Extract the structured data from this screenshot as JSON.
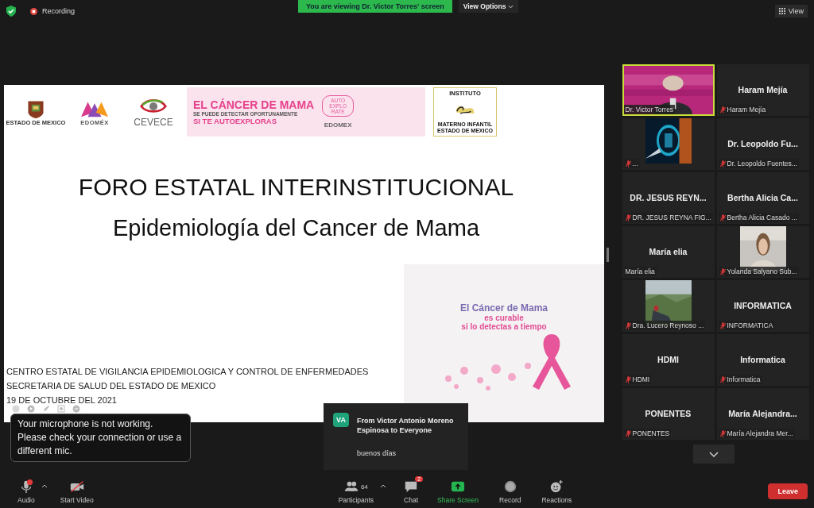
{
  "top_bar": {
    "recording_label": "Recording",
    "viewing_banner": "You are viewing Dr. Victor Torres' screen",
    "view_options": "View Options",
    "view_button": "View"
  },
  "slide": {
    "logos": [
      {
        "kind": "crest",
        "caption": "ESTADO DE MEXICO"
      },
      {
        "kind": "edomex",
        "caption": "EDOMÉX"
      },
      {
        "kind": "eye",
        "caption": "CEVECE"
      }
    ],
    "banner": {
      "headline": "EL CÁNCER DE MAMA",
      "line_2": "SE PUEDE DETECTAR OPORTUNAMENTE",
      "line_3": "SI TE AUTOEXPLORAS",
      "badge": "AUTO EXPLO RATE",
      "footer_logo": "EDOMEX"
    },
    "institute": {
      "top": "INSTITUTO",
      "bottom": "MATERNO INFANTIL ESTADO DE MEXICO"
    },
    "title": "FORO ESTATAL INTERINSTITUCIONAL",
    "subtitle": "Epidemiología del Cancer de Mama",
    "footer_lines": [
      "CENTRO ESTATAL DE VIGILANCIA EPIDEMIOLOGICA Y CONTROL DE ENFERMEDADES",
      "SECRETARIA DE SALUD DEL ESTADO DE MEXICO",
      "19 DE OCTUBRE DEL 2021"
    ],
    "poster": {
      "line_1": "El Cáncer de Mama",
      "line_2": "es curable",
      "line_3": "si lo detectas a tiempo"
    }
  },
  "participants": [
    {
      "kind": "video",
      "label": "Dr. Victor Torres",
      "muted": false,
      "speaking": true
    },
    {
      "kind": "name",
      "display": "Haram Mejía",
      "label": "Haram Mejía",
      "muted": true,
      "speaking": false
    },
    {
      "kind": "video",
      "label": "...",
      "muted": true,
      "speaking": false
    },
    {
      "kind": "name",
      "display": "Dr. Leopoldo Fu...",
      "label": "Dr. Leopoldo Fuentes...",
      "muted": true,
      "speaking": false
    },
    {
      "kind": "name",
      "display": "DR. JESUS REYN...",
      "label": "DR. JESUS REYNA FIG...",
      "muted": true,
      "speaking": false
    },
    {
      "kind": "name",
      "display": "Bertha Alicia Ca...",
      "label": "Bertha Alicia Casado ...",
      "muted": true,
      "speaking": false
    },
    {
      "kind": "name",
      "display": "María elia",
      "label": "María elia",
      "muted": false,
      "speaking": false
    },
    {
      "kind": "video",
      "label": "Yolanda Salyano Sub...",
      "muted": true,
      "speaking": false
    },
    {
      "kind": "video",
      "label": "Dra. Lucero Reynoso ...",
      "muted": true,
      "speaking": false
    },
    {
      "kind": "name",
      "display": "INFORMATICA",
      "label": "INFORMATICA",
      "muted": true,
      "speaking": false
    },
    {
      "kind": "name",
      "display": "HDMI",
      "label": "HDMI",
      "muted": true,
      "speaking": false
    },
    {
      "kind": "name",
      "display": "Informatica",
      "label": "Informatica",
      "muted": true,
      "speaking": false
    },
    {
      "kind": "name",
      "display": "PONENTES",
      "label": "PONENTES",
      "muted": true,
      "speaking": false
    },
    {
      "kind": "name",
      "display": "María  Alejandra...",
      "label": "María Alejandra Mer...",
      "muted": true,
      "speaking": false
    }
  ],
  "mic_warning": "Your microphone is not working. Please check your connection or use a different mic.",
  "chat_popup": {
    "initials": "VA",
    "sender": "From Victor Antonio Moreno Espinosa to Everyone",
    "message": "buenos días"
  },
  "toolbar": [
    {
      "kind": "audio",
      "label": "Audio"
    },
    {
      "kind": "video",
      "label": "Start Video"
    },
    {
      "kind": "participants",
      "label": "Participants",
      "count": "64"
    },
    {
      "kind": "chat",
      "label": "Chat",
      "badge": "2"
    },
    {
      "kind": "share",
      "label": "Share Screen"
    },
    {
      "kind": "record",
      "label": "Record"
    },
    {
      "kind": "reactions",
      "label": "Reactions"
    }
  ],
  "leave_button": "Leave"
}
